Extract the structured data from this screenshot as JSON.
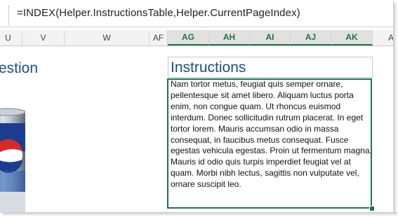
{
  "formula_bar": {
    "formula": "=INDEX(Helper.InstructionsTable,Helper.CurrentPageIndex)"
  },
  "columns": [
    {
      "label": "U"
    },
    {
      "label": "V"
    },
    {
      "label": "W"
    },
    {
      "label": "AF"
    },
    {
      "label": "AG"
    },
    {
      "label": "AH"
    },
    {
      "label": "AI"
    },
    {
      "label": "AJ"
    },
    {
      "label": "AK"
    },
    {
      "label": "AL"
    }
  ],
  "sheet": {
    "question_partial": "estion",
    "instructions_title": "Instructions",
    "instructions_body": "Nam tortor metus, feugiat quis semper ornare, pellentesque sit amet libero. Aliquam luctus porta enim, non congue quam. Ut rhoncus euismod interdum. Donec sollicitudin rutrum placerat. In eget tortor lorem. Mauris accumsan odio in massa consequat, in faucibus metus consequat. Fusce egestas vehicula egestas. Proin ut fermentum magna. Mauris id odio quis turpis imperdiet feugiat vel at quam. Morbi nibh lectus, sagittis non vulputate vel, ornare suscipit leo."
  },
  "colors": {
    "selection_green": "#217346",
    "heading_blue": "#1f4e79"
  },
  "icons": [
    "pepsi-can-image"
  ]
}
